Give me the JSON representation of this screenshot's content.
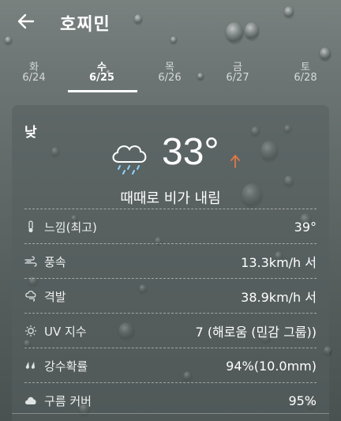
{
  "header": {
    "title": "호찌민"
  },
  "days": [
    {
      "name": "화",
      "date": "6/24"
    },
    {
      "name": "수",
      "date": "6/25"
    },
    {
      "name": "목",
      "date": "6/26"
    },
    {
      "name": "금",
      "date": "6/27"
    },
    {
      "name": "토",
      "date": "6/28"
    }
  ],
  "selected_day": "수",
  "card": {
    "title": "낮",
    "temperature": "33°",
    "condition": "때때로 비가 내림",
    "trend_color": "#e0784a",
    "details": [
      {
        "icon": "thermometer-icon",
        "label": "느낌(최고)",
        "value": "39°"
      },
      {
        "icon": "wind-icon",
        "label": "풍속",
        "value": "13.3km/h 서"
      },
      {
        "icon": "gust-icon",
        "label": "격발",
        "value": "38.9km/h 서"
      },
      {
        "icon": "sun-icon",
        "label": "UV 지수",
        "value": "7 (해로움 (민감 그룹))"
      },
      {
        "icon": "rain-drops-icon",
        "label": "강수확률",
        "value": "94%(10.0mm)"
      },
      {
        "icon": "cloud-icon",
        "label": "구름 커버",
        "value": "95%"
      }
    ]
  }
}
